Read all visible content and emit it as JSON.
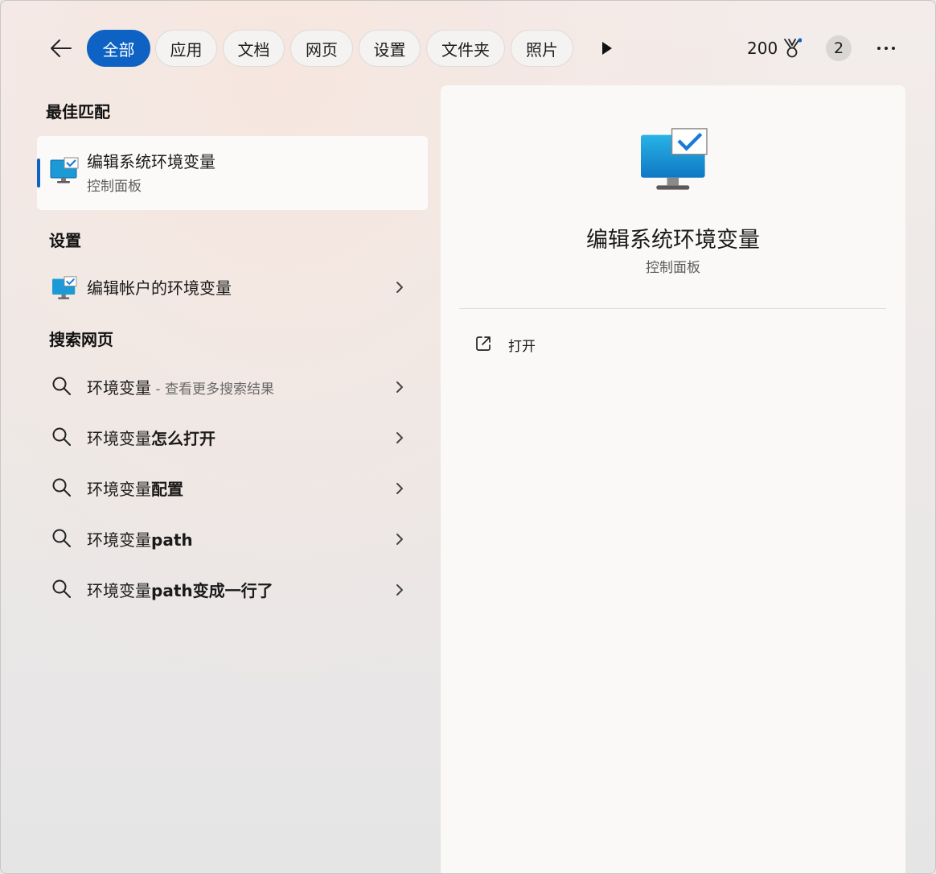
{
  "filters": {
    "tabs": [
      {
        "label": "全部",
        "active": true
      },
      {
        "label": "应用"
      },
      {
        "label": "文档"
      },
      {
        "label": "网页"
      },
      {
        "label": "设置"
      },
      {
        "label": "文件夹"
      },
      {
        "label": "照片"
      }
    ],
    "points": "200",
    "avatar_text": "2"
  },
  "best_match": {
    "section_title": "最佳匹配",
    "item": {
      "title": "编辑系统环境变量",
      "subtitle": "控制面板",
      "icon": "monitor-check-icon"
    }
  },
  "settings": {
    "section_title": "设置",
    "items": [
      {
        "label": "编辑帐户的环境变量",
        "icon": "monitor-check-icon"
      }
    ]
  },
  "web": {
    "section_title": "搜索网页",
    "items": [
      {
        "plain": "环境变量",
        "bold": "",
        "sub": " - 查看更多搜索结果"
      },
      {
        "plain": "环境变量",
        "bold": "怎么打开",
        "sub": ""
      },
      {
        "plain": "环境变量",
        "bold": "配置",
        "sub": ""
      },
      {
        "plain": "环境变量",
        "bold": "path",
        "sub": ""
      },
      {
        "plain": "环境变量",
        "bold": "path变成一行了",
        "sub": ""
      }
    ]
  },
  "detail": {
    "title": "编辑系统环境变量",
    "subtitle": "控制面板",
    "actions": [
      {
        "label": "打开",
        "icon": "open-external-icon"
      }
    ]
  },
  "colors": {
    "accent": "#0d62c4",
    "panel": "#fbf9f8"
  }
}
